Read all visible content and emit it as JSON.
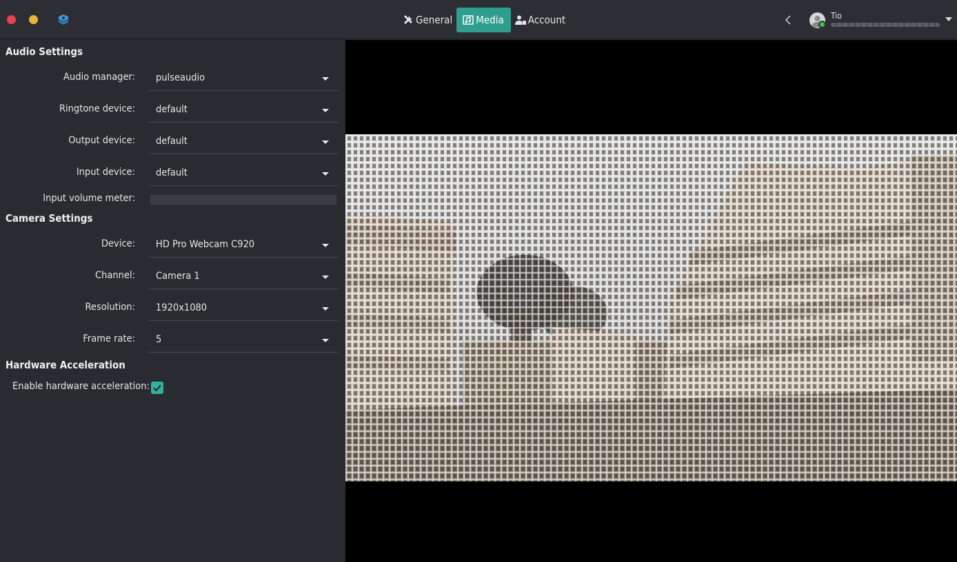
{
  "header": {
    "tabs": [
      {
        "label": "General",
        "icon": "tools-icon"
      },
      {
        "label": "Media",
        "icon": "media-icon",
        "active": true
      },
      {
        "label": "Account",
        "icon": "account-icon"
      }
    ],
    "user": {
      "name": "Tio",
      "status_color": "#3fc24b"
    }
  },
  "audio": {
    "title": "Audio Settings",
    "audio_manager": {
      "label": "Audio manager:",
      "value": "pulseaudio"
    },
    "ringtone_device": {
      "label": "Ringtone device:",
      "value": "default"
    },
    "output_device": {
      "label": "Output device:",
      "value": "default"
    },
    "input_device": {
      "label": "Input device:",
      "value": "default"
    },
    "input_volume_meter": {
      "label": "Input volume meter:",
      "level": 0
    }
  },
  "camera": {
    "title": "Camera Settings",
    "device": {
      "label": "Device:",
      "value": "HD Pro Webcam C920"
    },
    "channel": {
      "label": "Channel:",
      "value": "Camera 1"
    },
    "resolution": {
      "label": "Resolution:",
      "value": "1920x1080"
    },
    "frame_rate": {
      "label": "Frame rate:",
      "value": "5"
    }
  },
  "hardware": {
    "title": "Hardware Acceleration",
    "enable": {
      "label": "Enable hardware acceleration:",
      "checked": true
    }
  },
  "colors": {
    "accent": "#2f9e8c",
    "checkbox": "#2fb39c",
    "close": "#e2444e",
    "minimize": "#e8b437"
  }
}
